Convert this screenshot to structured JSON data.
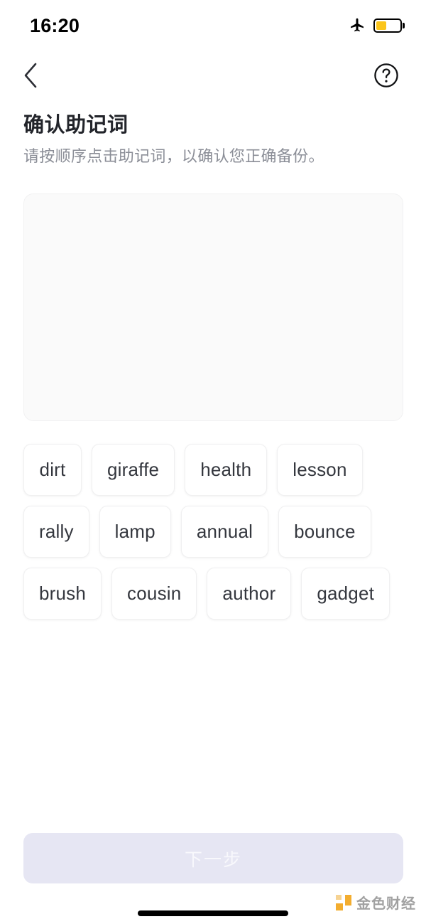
{
  "status_bar": {
    "time": "16:20",
    "airplane_icon": "airplane-mode-icon",
    "battery_icon": "battery-icon",
    "battery_level_percent": 45,
    "battery_color": "#fbc51b"
  },
  "nav": {
    "back_icon": "chevron-left-icon",
    "help_icon": "question-mark-circle-icon"
  },
  "header": {
    "title": "确认助记词",
    "subtitle": "请按顺序点击助记词，以确认您正确备份。"
  },
  "selected_area": {
    "words": [],
    "background_color": "#fafafa"
  },
  "word_pool": {
    "words": [
      "dirt",
      "giraffe",
      "health",
      "lesson",
      "rally",
      "lamp",
      "annual",
      "bounce",
      "brush",
      "cousin",
      "author",
      "gadget"
    ]
  },
  "footer": {
    "next_label": "下一步",
    "next_disabled": true,
    "next_background_color": "#e6e6f3",
    "next_text_color": "#f8f8fc"
  },
  "watermark": {
    "text": "金色财经",
    "mark_color": "#f3a71e"
  }
}
